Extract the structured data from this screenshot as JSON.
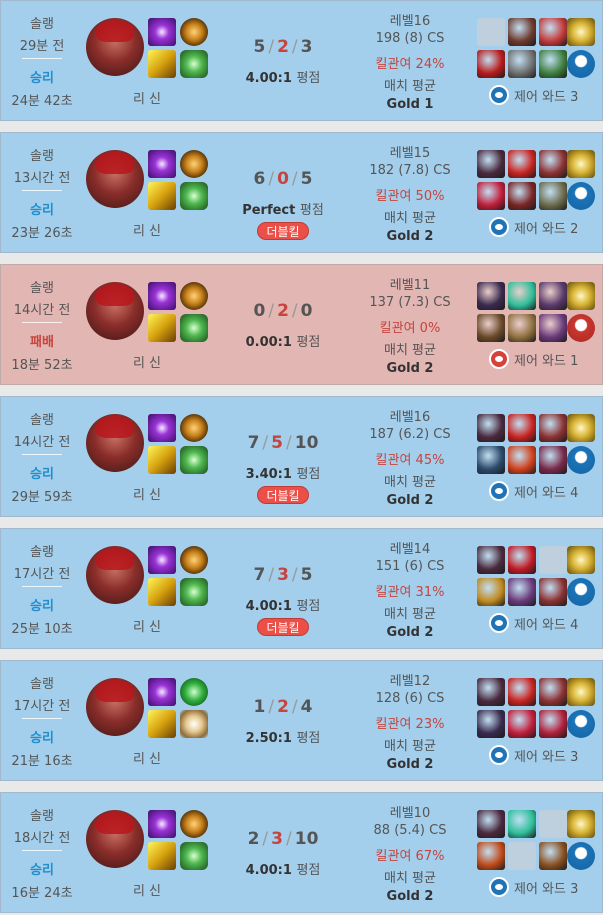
{
  "matches": [
    {
      "queue": "솔랭",
      "ago": "29분 전",
      "result": "승리",
      "duration": "24분 42초",
      "champion": "리 신",
      "spell1": "flash",
      "spell2": "smite",
      "rune1": "precision",
      "rune2": "resolve",
      "kills": "5",
      "deaths": "2",
      "assists": "3",
      "ratio": "4.00:1",
      "ratio_unit": "평점",
      "multikill": "",
      "level": "레벨16",
      "cs": "198 (8) CS",
      "kp": "킬관여 24%",
      "avg": "매치 평균",
      "tier": "Gold 1",
      "ward_label": "제어 와드 3",
      "outcome": "win",
      "items": [
        {
          "color": "#9aaac0"
        },
        {
          "color": "#6e3b2e"
        },
        {
          "color": "#c33a3a"
        },
        {
          "color": "#b71c1c"
        },
        {
          "color": "#6f6f6f"
        },
        {
          "color": "#3f7f3f"
        }
      ]
    },
    {
      "queue": "솔랭",
      "ago": "13시간 전",
      "result": "승리",
      "duration": "23분 26초",
      "champion": "리 신",
      "spell1": "flash",
      "spell2": "smite",
      "rune1": "precision",
      "rune2": "resolve",
      "kills": "6",
      "deaths": "0",
      "assists": "5",
      "ratio": "Perfect",
      "ratio_unit": "평점",
      "multikill": "더블킬",
      "level": "레벨15",
      "cs": "182 (7.8) CS",
      "kp": "킬관여 50%",
      "avg": "매치 평균",
      "tier": "Gold 2",
      "ward_label": "제어 와드 2",
      "outcome": "win",
      "items": [
        {
          "color": "#4b2a3e"
        },
        {
          "color": "#c8231f"
        },
        {
          "color": "#8b3131"
        },
        {
          "color": "#c11e3a"
        },
        {
          "color": "#7a2525"
        },
        {
          "color": "#6b6b4b"
        }
      ]
    },
    {
      "queue": "솔랭",
      "ago": "14시간 전",
      "result": "패배",
      "duration": "18분 52초",
      "champion": "리 신",
      "spell1": "flash",
      "spell2": "smite",
      "rune1": "precision",
      "rune2": "resolve",
      "kills": "0",
      "deaths": "2",
      "assists": "0",
      "ratio": "0.00:1",
      "ratio_unit": "평점",
      "multikill": "",
      "level": "레벨11",
      "cs": "137 (7.3) CS",
      "kp": "킬관여 0%",
      "avg": "매치 평균",
      "tier": "Gold 2",
      "ward_label": "제어 와드 1",
      "outcome": "loss",
      "items": [
        {
          "color": "#3a2a4e"
        },
        {
          "color": "#2fbf9a"
        },
        {
          "color": "#5a3a6a"
        },
        {
          "color": "#6a4a2a"
        },
        {
          "color": "#8f7040"
        },
        {
          "color": "#6a3a7a"
        }
      ]
    },
    {
      "queue": "솔랭",
      "ago": "14시간 전",
      "result": "승리",
      "duration": "29분 59초",
      "champion": "리 신",
      "spell1": "flash",
      "spell2": "smite",
      "rune1": "precision",
      "rune2": "resolve",
      "kills": "7",
      "deaths": "5",
      "assists": "10",
      "ratio": "3.40:1",
      "ratio_unit": "평점",
      "multikill": "더블킬",
      "level": "레벨16",
      "cs": "187 (6.2) CS",
      "kp": "킬관여 45%",
      "avg": "매치 평균",
      "tier": "Gold 2",
      "ward_label": "제어 와드 4",
      "outcome": "win",
      "items": [
        {
          "color": "#4b2a3e"
        },
        {
          "color": "#c8231f"
        },
        {
          "color": "#8b3131"
        },
        {
          "color": "#2c4a6a"
        },
        {
          "color": "#d0401c"
        },
        {
          "color": "#7a2a4a"
        }
      ]
    },
    {
      "queue": "솔랭",
      "ago": "17시간 전",
      "result": "승리",
      "duration": "25분 10초",
      "champion": "리 신",
      "spell1": "flash",
      "spell2": "smite",
      "rune1": "precision",
      "rune2": "resolve",
      "kills": "7",
      "deaths": "3",
      "assists": "5",
      "ratio": "4.00:1",
      "ratio_unit": "평점",
      "multikill": "더블킬",
      "level": "레벨14",
      "cs": "151 (6) CS",
      "kp": "킬관여 31%",
      "avg": "매치 평균",
      "tier": "Gold 2",
      "ward_label": "제어 와드 4",
      "outcome": "win",
      "items": [
        {
          "color": "#4b2a3e"
        },
        {
          "color": "#c01a24"
        },
        {
          "color": "#9aaac0"
        },
        {
          "color": "#c08a20"
        },
        {
          "color": "#6a3a7a"
        },
        {
          "color": "#8b3131"
        }
      ]
    },
    {
      "queue": "솔랭",
      "ago": "17시간 전",
      "result": "승리",
      "duration": "21분 16초",
      "champion": "리 신",
      "spell1": "flash",
      "spell2": "smite",
      "rune1": "inspiration",
      "rune2": "domination",
      "kills": "1",
      "deaths": "2",
      "assists": "4",
      "ratio": "2.50:1",
      "ratio_unit": "평점",
      "multikill": "",
      "level": "레벨12",
      "cs": "128 (6) CS",
      "kp": "킬관여 23%",
      "avg": "매치 평균",
      "tier": "Gold 2",
      "ward_label": "제어 와드 3",
      "outcome": "win",
      "items": [
        {
          "color": "#4b2a3e"
        },
        {
          "color": "#c8231f"
        },
        {
          "color": "#8b3131"
        },
        {
          "color": "#3a2a4e"
        },
        {
          "color": "#c11e3a"
        },
        {
          "color": "#b0203a"
        }
      ]
    },
    {
      "queue": "솔랭",
      "ago": "18시간 전",
      "result": "승리",
      "duration": "16분 24초",
      "champion": "리 신",
      "spell1": "flash",
      "spell2": "smite",
      "rune1": "precision",
      "rune2": "resolve",
      "kills": "2",
      "deaths": "3",
      "assists": "10",
      "ratio": "4.00:1",
      "ratio_unit": "평점",
      "multikill": "",
      "level": "레벨10",
      "cs": "88 (5.4) CS",
      "kp": "킬관여 67%",
      "avg": "매치 평균",
      "tier": "Gold 2",
      "ward_label": "제어 와드 3",
      "outcome": "win",
      "items": [
        {
          "color": "#4b2a3e"
        },
        {
          "color": "#2fbf9a"
        },
        {
          "color": "#9aaac0"
        },
        {
          "color": "#c04a1a"
        },
        {
          "color": "#9aaac0"
        },
        {
          "color": "#8a5020"
        }
      ]
    }
  ]
}
